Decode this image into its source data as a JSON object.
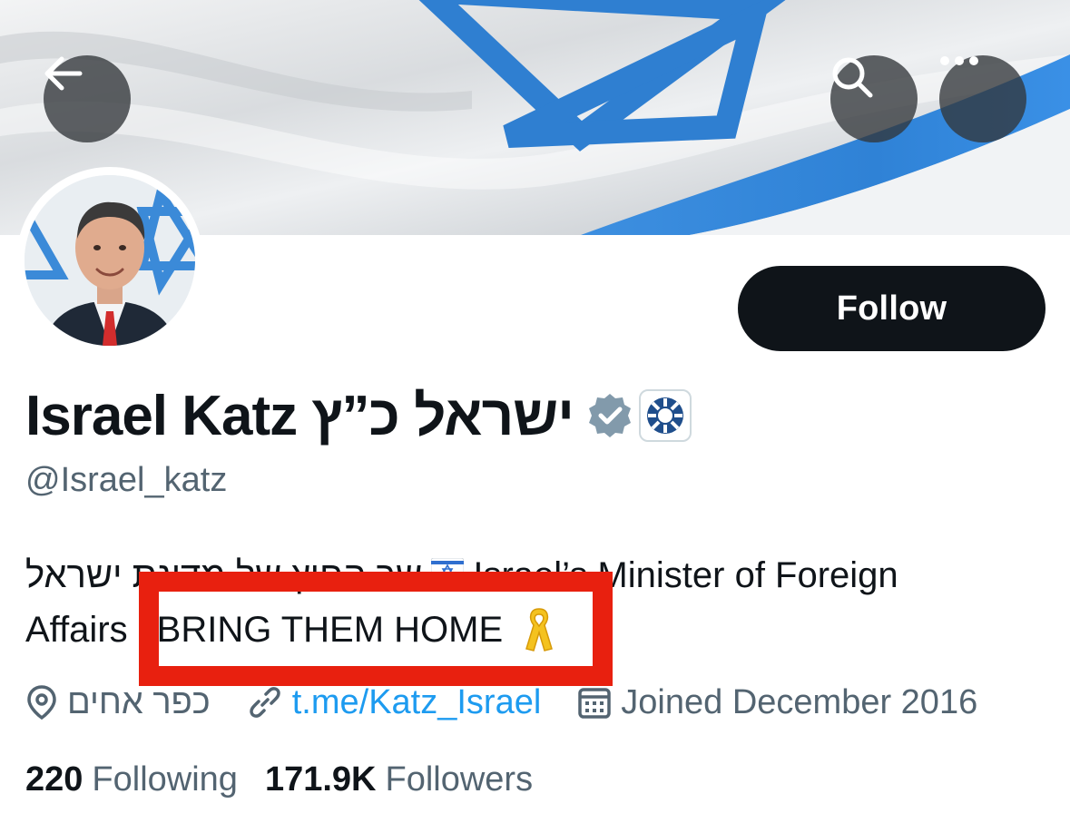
{
  "header": {
    "back_icon": "arrow-left-icon",
    "search_icon": "search-icon",
    "more_icon": "more-horizontal-icon"
  },
  "profile": {
    "display_name": "Israel Katz ישראל כ”ץ",
    "handle": "@Israel_katz",
    "follow_label": "Follow",
    "badges": [
      "verified-badge-icon",
      "government-affiliation-icon"
    ],
    "bio_line1_hebrew": "שר החוץ של מדינת ישראל",
    "bio_line1_english": "Israel’s Minister of Foreign",
    "bio_line2_prefix": "Affairs",
    "bio_highlight": "BRING THEM HOME"
  },
  "meta": {
    "location": "כפר אחים",
    "link": "t.me/Katz_Israel",
    "joined": "Joined December 2016"
  },
  "stats": {
    "following_count": "220",
    "following_label": "Following",
    "followers_count": "171.9K",
    "followers_label": "Followers"
  },
  "colors": {
    "link": "#1d9bf0",
    "muted_text": "#536471",
    "primary_text": "#0f1419",
    "highlight_box": "#e8200f",
    "flag_blue": "#2f7fd1"
  }
}
